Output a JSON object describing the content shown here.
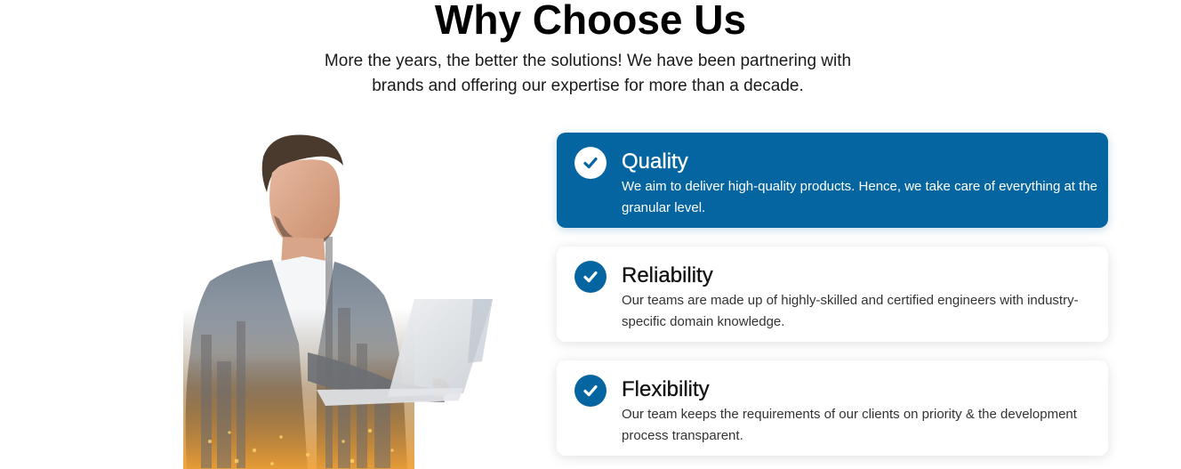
{
  "section": {
    "title": "Why Choose Us",
    "subtitle": "More the years, the better the solutions! We have been partnering with brands and offering our expertise for more than a decade."
  },
  "features": [
    {
      "title": "Quality",
      "description": "We aim to deliver high-quality products. Hence, we take care of everything at the granular level.",
      "active": true
    },
    {
      "title": "Reliability",
      "description": "Our teams are made up of highly-skilled and certified engineers with industry-specific domain knowledge.",
      "active": false
    },
    {
      "title": "Flexibility",
      "description": "Our team keeps the requirements of our clients on priority & the development process transparent.",
      "active": false
    }
  ],
  "icons": {
    "feature_check": "check-circle-icon",
    "hero": "businessman-with-laptop-illustration"
  },
  "colors": {
    "brand_blue": "#0565a0",
    "card_bg": "#ffffff",
    "text_dark": "#111111"
  }
}
